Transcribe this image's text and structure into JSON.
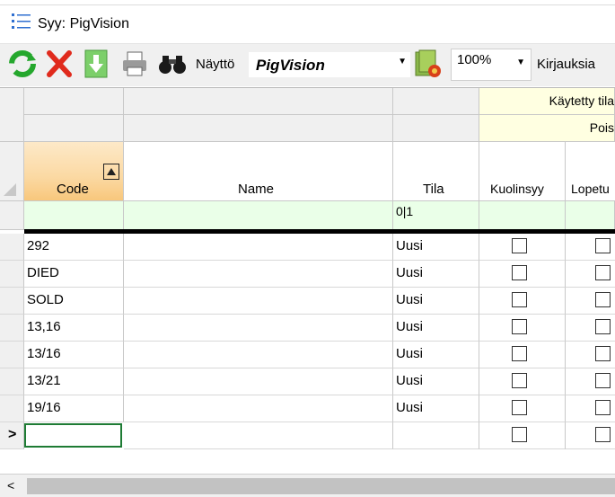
{
  "window": {
    "title": "Syy: PigVision"
  },
  "toolbar": {
    "view_label": "Näyttö",
    "view_value": "PigVision",
    "zoom_value": "100%",
    "entries_label": "Kirjauksia",
    "icons": [
      "refresh-icon",
      "delete-icon",
      "download-icon",
      "print-icon",
      "binoculars-icon",
      "settings-icon"
    ]
  },
  "grid": {
    "group_header": "Käytetty tila",
    "group_subheader": "Pois",
    "columns": {
      "code": "Code",
      "name": "Name",
      "tila": "Tila",
      "kuolinsyy": "Kuolinsyy",
      "lopetus": "Lopetu"
    },
    "filter": {
      "tila": "0|1"
    },
    "rows": [
      {
        "code": "292",
        "name": "",
        "tila": "Uusi"
      },
      {
        "code": "DIED",
        "name": "",
        "tila": "Uusi"
      },
      {
        "code": "SOLD",
        "name": "",
        "tila": "Uusi"
      },
      {
        "code": "13,16",
        "name": "",
        "tila": "Uusi"
      },
      {
        "code": "13/16",
        "name": "",
        "tila": "Uusi"
      },
      {
        "code": "13/21",
        "name": "",
        "tila": "Uusi"
      },
      {
        "code": "19/16",
        "name": "",
        "tila": "Uusi"
      }
    ],
    "new_row_marker": ">",
    "colors": {
      "sort_header": "#fbd9a3",
      "group_header": "#ffffe1",
      "filter_row": "#eaffe8",
      "current_cell_border": "#1e7b34"
    }
  },
  "scrollbar": {
    "left_arrow": "<"
  }
}
